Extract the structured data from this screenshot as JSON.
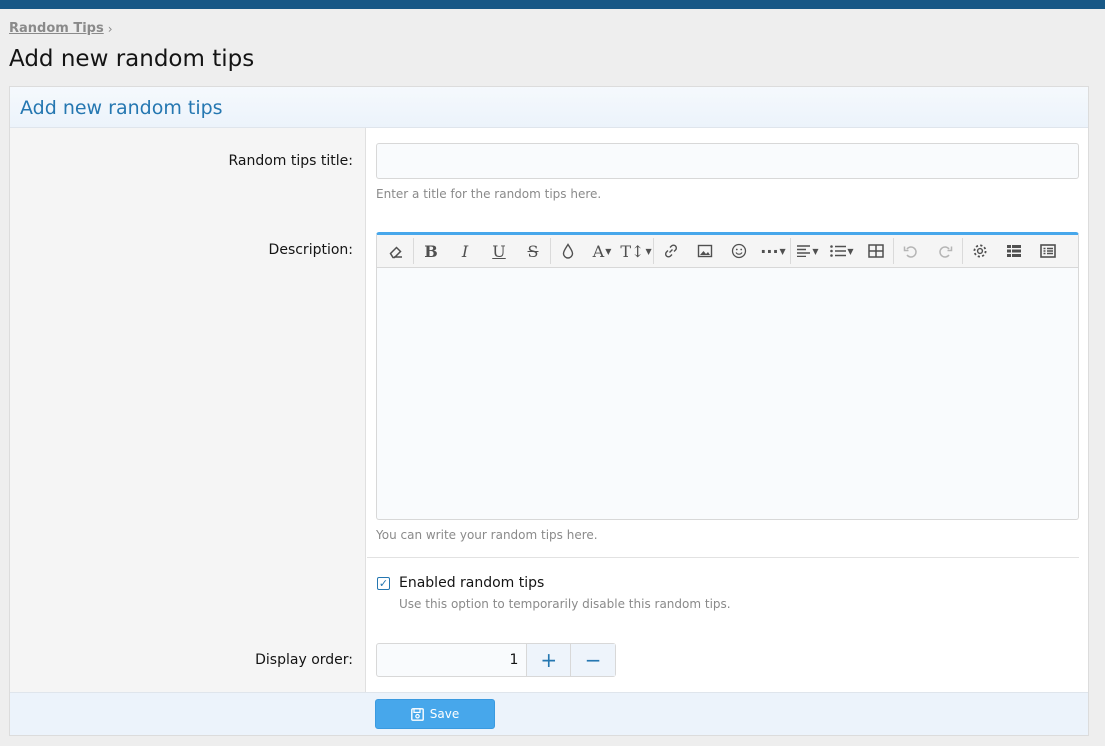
{
  "breadcrumb": {
    "link": "Random Tips",
    "chevron": "›"
  },
  "page": {
    "title": "Add new random tips"
  },
  "form": {
    "header": "Add new random tips",
    "title_field": {
      "label": "Random tips title:",
      "value": "",
      "hint": "Enter a title for the random tips here."
    },
    "description": {
      "label": "Description:",
      "hint": "You can write your random tips here.",
      "toolbar": [
        "eraser-icon",
        "bold-icon",
        "italic-icon",
        "underline-icon",
        "strikethrough-icon",
        "color-drop-icon",
        "font-family-icon",
        "font-size-icon",
        "link-icon",
        "image-icon",
        "smiley-icon",
        "more-icon",
        "align-icon",
        "list-icon",
        "table-icon",
        "undo-icon",
        "redo-icon",
        "settings-icon",
        "preview-icon",
        "drafts-icon"
      ]
    },
    "enabled": {
      "label": "Enabled random tips",
      "hint": "Use this option to temporarily disable this random tips.",
      "checked": true
    },
    "display_order": {
      "label": "Display order:",
      "value": "1",
      "plus": "+",
      "minus": "−"
    },
    "save_label": "Save"
  },
  "colors": {
    "accent": "#2577b1",
    "button": "#47a7eb",
    "topbar": "#185886"
  }
}
